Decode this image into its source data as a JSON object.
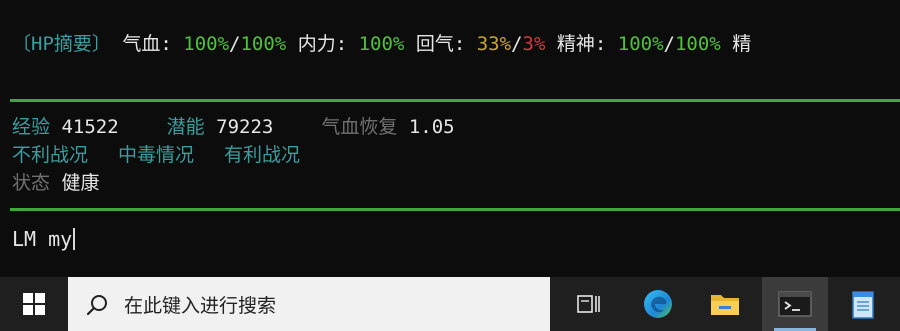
{
  "terminal": {
    "hp_line": {
      "prefix": "〔HP摘要〕",
      "qixue_label": "气血:",
      "qixue_value1": "100%",
      "qixue_sep": "/",
      "qixue_value2": "100%",
      "neili_label": "内力:",
      "neili_value": "100%",
      "huiqi_label": "回气:",
      "huiqi_value1": "33%",
      "huiqi_sep": "/",
      "huiqi_value2": "3%",
      "jingshen_label": "精神:",
      "jingshen_value1": "100%",
      "jingshen_sep": "/",
      "jingshen_value2": "100%",
      "trailing": "精"
    },
    "stats": {
      "exp_label": "经验",
      "exp_value": "41522",
      "potential_label": "潜能",
      "potential_value": "79223",
      "regen_label": "气血恢复",
      "regen_value": "1.05"
    },
    "conditions": {
      "adverse": "不利战况",
      "poison": "中毒情况",
      "favorable": "有利战况"
    },
    "status": {
      "label": "状态",
      "value": "健康"
    },
    "input": {
      "text": "LM my"
    }
  },
  "taskbar": {
    "search_placeholder": "在此键入进行搜索",
    "icons": [
      "windows-logo-icon",
      "search-icon",
      "task-view-icon",
      "edge-icon",
      "file-explorer-icon",
      "terminal-icon",
      "notepad-icon"
    ]
  },
  "colors": {
    "background": "#0c0c0c",
    "teal": "#3a9c9c",
    "green": "#4fc23a",
    "yellow": "#c9a431",
    "red": "#d03a3a",
    "rule": "#3ea83a",
    "taskbar": "#1f1f1f"
  }
}
